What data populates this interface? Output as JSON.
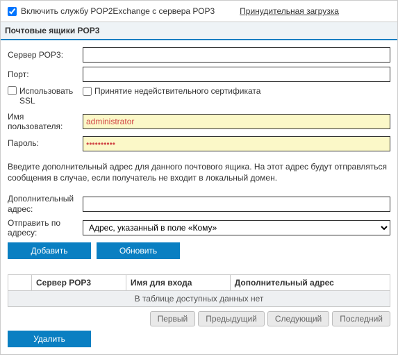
{
  "top": {
    "enable_label": "Включить службу POP2Exchange с сервера РОР3",
    "force_link": "Принудительная загрузка"
  },
  "section_title": "Почтовые ящики РОР3",
  "form": {
    "server_label": "Сервер РОР3:",
    "server_value": "",
    "port_label": "Порт:",
    "port_value": "",
    "use_ssl_label": "Использовать SSL",
    "accept_invalid_cert_label": "Принятие недействительного сертификата",
    "username_label": "Имя пользователя:",
    "username_value": "administrator",
    "password_label": "Пароль:",
    "password_value": "••••••••••",
    "help_text": "Введите дополнительный адрес для данного почтового ящика. На этот адрес будут отправляться сообщения в случае, если получатель не входит в локальный домен.",
    "alt_addr_label": "Дополнительный адрес:",
    "alt_addr_value": "",
    "send_to_label": "Отправить по адресу:",
    "send_to_selected": "Адрес, указанный в поле «Кому»"
  },
  "buttons": {
    "add": "Добавить",
    "update": "Обновить",
    "delete": "Удалить"
  },
  "table": {
    "columns": [
      "Сервер РОР3",
      "Имя для входа",
      "Дополнительный адрес"
    ],
    "empty_text": "В таблице доступных данных нет"
  },
  "pager": {
    "first": "Первый",
    "prev": "Предыдущий",
    "next": "Следующий",
    "last": "Последний"
  }
}
